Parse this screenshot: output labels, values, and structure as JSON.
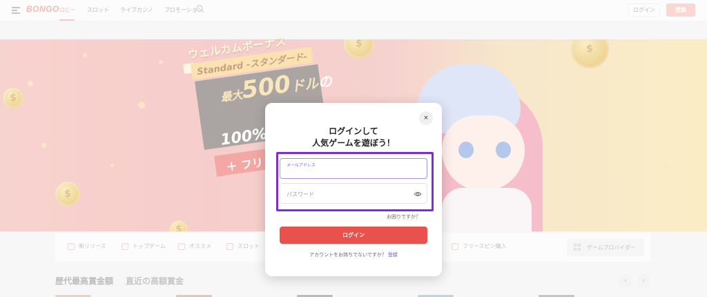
{
  "header": {
    "logo": "BONGO",
    "nav": [
      {
        "label": "ロビー",
        "active": true
      },
      {
        "label": "スロット"
      },
      {
        "label": "ライブカジノ"
      },
      {
        "label": "プロモーション"
      }
    ],
    "login_label": "ログイン",
    "register_label": "登録"
  },
  "banner": {
    "title": "ウェルカムボーナス",
    "subtitle": "Standard -スタンダード-",
    "max_prefix": "最大",
    "amount": "500",
    "unit": "ドル",
    "particle": "の",
    "percent": "100%",
    "plus": "＋ フリ"
  },
  "categories": {
    "items": [
      "新リリース",
      "トップゲーム",
      "オススメ",
      "スロット",
      "フリースピン購入"
    ],
    "provider_label": "ゲームプロバイダー"
  },
  "sections": {
    "title_primary": "歴代最高賞金額",
    "title_secondary": "直近の高額賞金",
    "prev": "‹",
    "next": "›"
  },
  "modal": {
    "close": "×",
    "title_line1": "ログインして",
    "title_line2": "人気ゲームを遊ぼう！",
    "email_label": "メールアドレス",
    "email_value": "",
    "password_placeholder": "パスワード",
    "forgot": "お困りですか？",
    "submit": "ログイン",
    "signup_prompt": "アカウントをお持ちでないですか？",
    "signup_link": "登録"
  },
  "colors": {
    "accent": "#e9524c",
    "highlight": "#7b2fd0",
    "link": "#7a4fd1"
  }
}
